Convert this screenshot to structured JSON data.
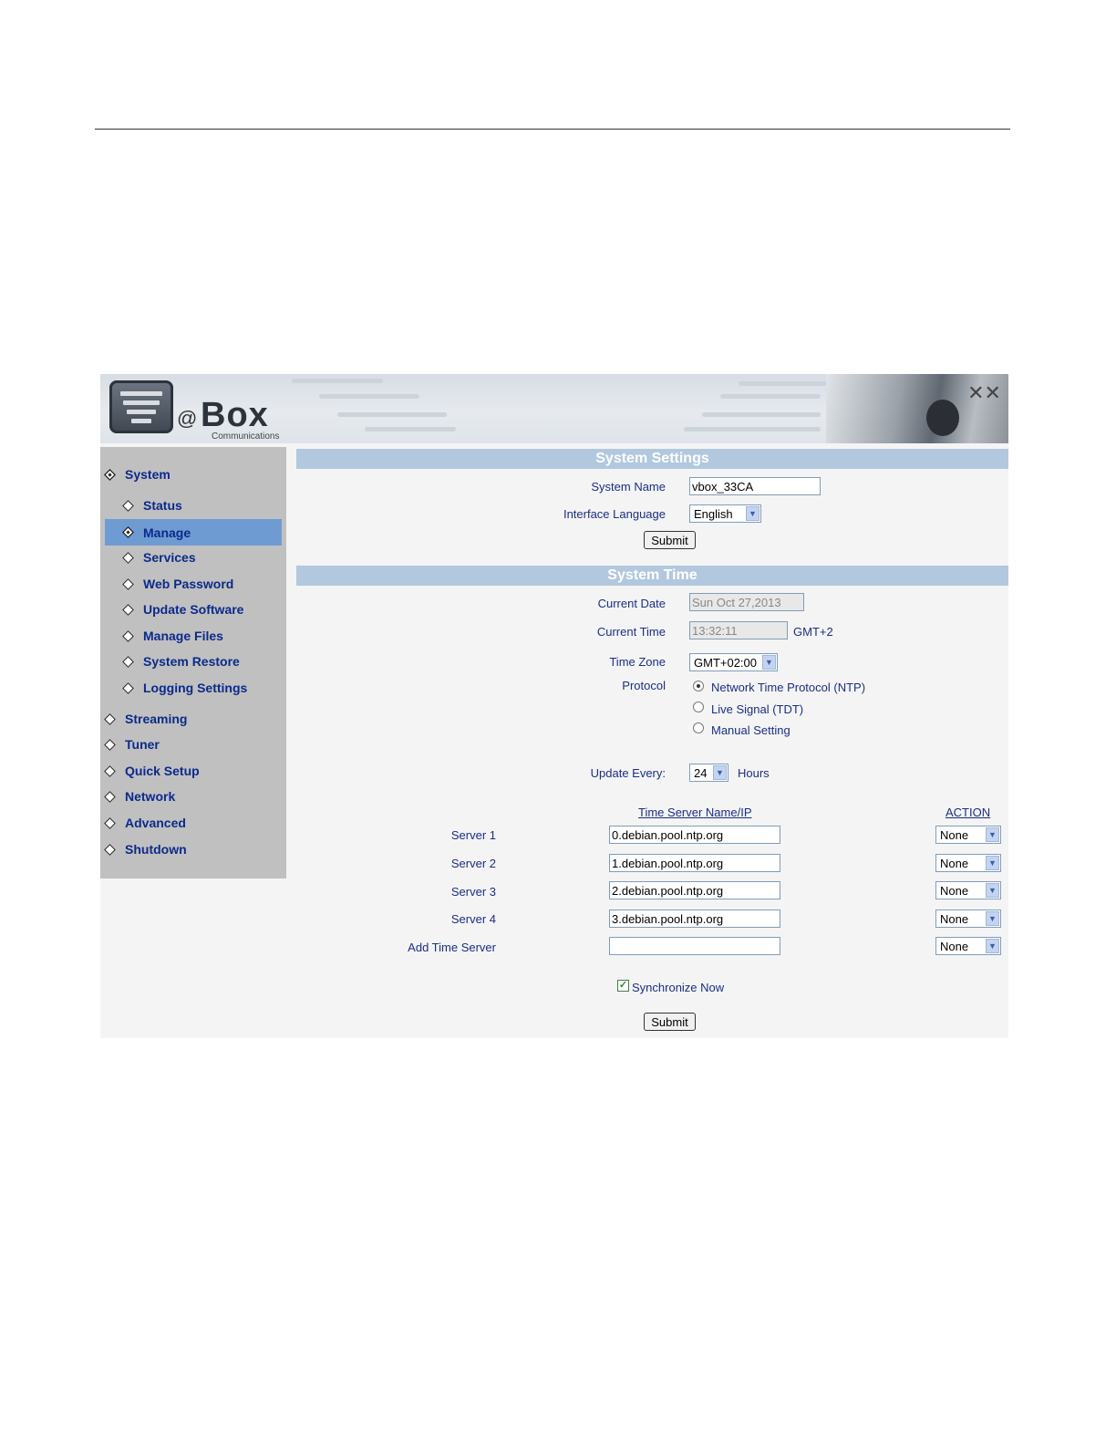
{
  "logo": {
    "at": "@",
    "box": "Box",
    "sub": "Communications"
  },
  "nav": {
    "items": [
      {
        "label": "System"
      },
      {
        "label": "Status"
      },
      {
        "label": "Manage"
      },
      {
        "label": "Services"
      },
      {
        "label": "Web Password"
      },
      {
        "label": "Update Software"
      },
      {
        "label": "Manage Files"
      },
      {
        "label": "System Restore"
      },
      {
        "label": "Logging Settings"
      },
      {
        "label": "Streaming"
      },
      {
        "label": "Tuner"
      },
      {
        "label": "Quick Setup"
      },
      {
        "label": "Network"
      },
      {
        "label": "Advanced"
      },
      {
        "label": "Shutdown"
      }
    ],
    "selected": "Manage"
  },
  "system_settings": {
    "title": "System Settings",
    "system_name_label": "System Name",
    "system_name_value": "vbox_33CA",
    "language_label": "Interface Language",
    "language_value": "English",
    "submit": "Submit"
  },
  "system_time": {
    "title": "System Time",
    "current_date_label": "Current Date",
    "current_date_value": "Sun Oct 27,2013",
    "current_time_label": "Current Time",
    "current_time_value": "13:32:11",
    "gmt_offset": "GMT+2",
    "timezone_label": "Time Zone",
    "timezone_value": "GMT+02:00",
    "protocol_label": "Protocol",
    "protocols": [
      {
        "label": "Network Time Protocol (NTP)",
        "selected": true
      },
      {
        "label": "Live Signal (TDT)",
        "selected": false
      },
      {
        "label": "Manual Setting",
        "selected": false
      }
    ],
    "update_label": "Update Every:",
    "update_value": "24",
    "update_unit": "Hours",
    "col_server": "Time Server Name/IP",
    "col_action": "ACTION",
    "servers": [
      {
        "label": "Server 1",
        "value": "0.debian.pool.ntp.org",
        "action": "None"
      },
      {
        "label": "Server 2",
        "value": "1.debian.pool.ntp.org",
        "action": "None"
      },
      {
        "label": "Server 3",
        "value": "2.debian.pool.ntp.org",
        "action": "None"
      },
      {
        "label": "Server 4",
        "value": "3.debian.pool.ntp.org",
        "action": "None"
      },
      {
        "label": "Add Time Server",
        "value": "",
        "action": "None"
      }
    ],
    "sync_label": "Synchronize Now",
    "sync_checked": true,
    "submit": "Submit"
  }
}
